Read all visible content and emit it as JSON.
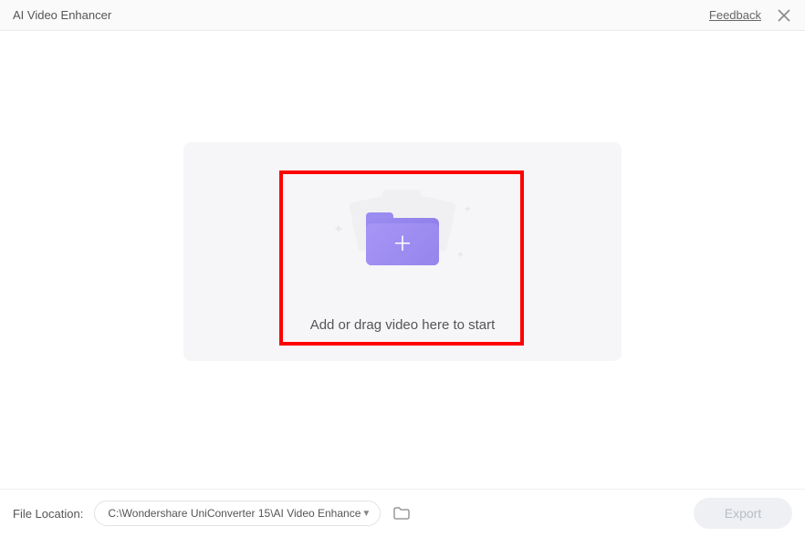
{
  "header": {
    "title": "AI Video Enhancer",
    "feedback_label": "Feedback"
  },
  "dropzone": {
    "prompt": "Add or drag video here to start",
    "icon": "folder-plus"
  },
  "footer": {
    "file_location_label": "File Location:",
    "path": "C:\\Wondershare UniConverter 15\\AI Video Enhance",
    "export_label": "Export"
  },
  "colors": {
    "accent_folder": "#9585ed",
    "highlight_box": "#ff0000",
    "export_disabled_bg": "#eef0f3"
  }
}
